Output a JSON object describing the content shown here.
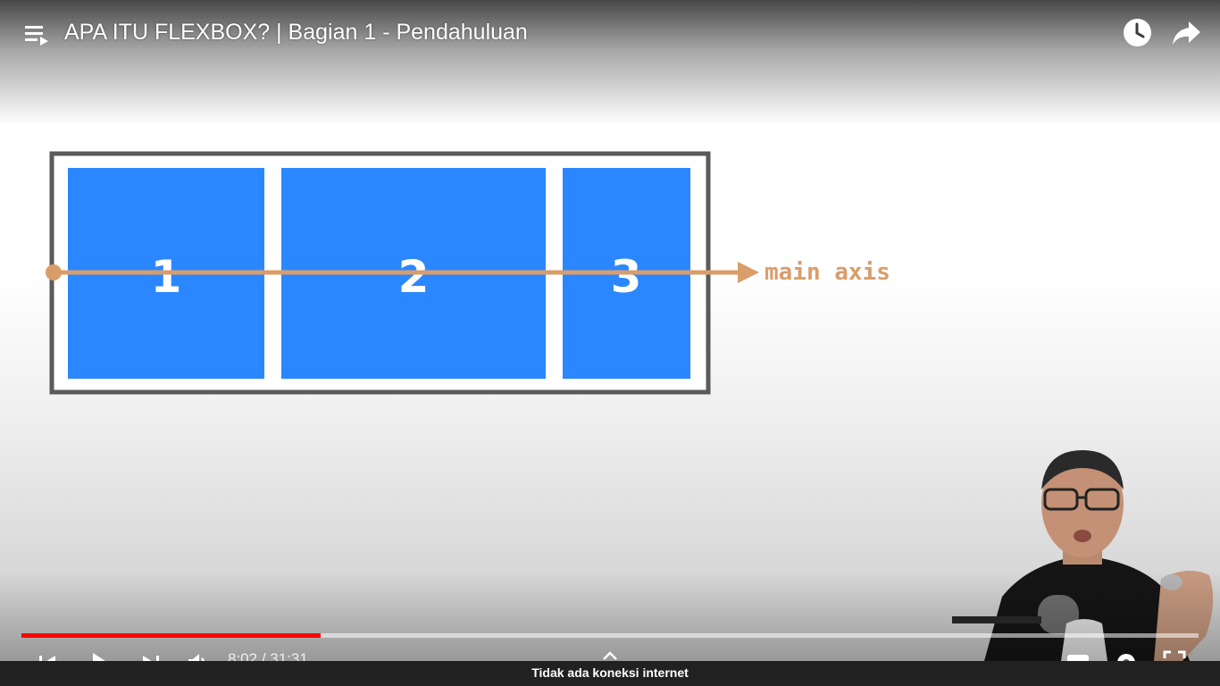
{
  "video": {
    "title": "APA ITU FLEXBOX? | Bagian 1 - Pendahuluan",
    "current_time": "8:02",
    "duration": "31:31",
    "time_separator": " / ",
    "progress_fraction": 0.2545
  },
  "slide": {
    "box_labels": [
      "1",
      "2",
      "3"
    ],
    "axis_label": "main axis",
    "colors": {
      "box_fill": "#2b87ff",
      "container_border": "#5a5a5a",
      "axis_color": "#d99d6a"
    }
  },
  "header": {
    "icons": [
      "playlist-icon",
      "watch-later-icon",
      "share-icon"
    ]
  },
  "controls": {
    "icons": [
      "previous-icon",
      "play-icon",
      "next-icon",
      "volume-icon",
      "chevron-up-icon",
      "subtitles-icon",
      "settings-icon",
      "fullscreen-icon"
    ],
    "progress_color": "#ff0000"
  },
  "status": {
    "offline_message": "Tidak ada koneksi internet"
  }
}
